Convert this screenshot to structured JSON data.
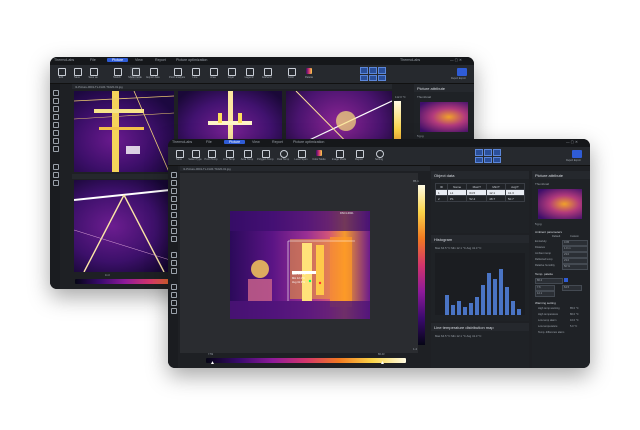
{
  "back_window": {
    "app_name": "ThermoLabs",
    "menus": [
      "File",
      "Picture",
      "View",
      "Report",
      "Picture optimization"
    ],
    "active_menu": "Picture",
    "ribbon_labels": [
      "Edit",
      "Save",
      "Save as",
      "Switch",
      "Show mode",
      "Export data",
      "Point analysis",
      "Line",
      "Area",
      "Layer",
      "Legend",
      "Isotherm",
      "Color",
      "Palette"
    ],
    "user": "ThermoLabs",
    "tab_title": "I1-Picture-0001-TL-FLIR-T1020-01.jpg",
    "panel_title": "Picture attribute",
    "panel_sub": "Thumbnail",
    "thumb_label": "5.jpg",
    "scale_max": "112.0 °C",
    "bar_low": "11.0",
    "report_button": "Report Export"
  },
  "front_window": {
    "app_name": "ThermoLabs",
    "menus": [
      "File",
      "Picture",
      "View",
      "Report",
      "Picture optimization"
    ],
    "active_menu": "Picture",
    "ribbon_labels": [
      "Save",
      "Select Type",
      "Point Temp",
      "Line Temp",
      "Area Temp",
      "Polygon Temp",
      "Oval Temp",
      "Level Span",
      "Color Mode",
      "Image Mode",
      "Report",
      "Setting"
    ],
    "report_button": "Report Export",
    "tab_title": "I1-Picture-0001-TL-FLIR-T1020-01.jpg",
    "scale_max": "85.1",
    "scale_min": "1.2",
    "bar_low": "7.59",
    "bar_high": "86.43",
    "image_caption": "DSC1-0021",
    "point_labels": [
      "Max 64.5°C",
      "Min 12.1°C",
      "Avg 41.3°C"
    ],
    "object_data": {
      "title": "Object data",
      "columns": [
        "ID",
        "Name",
        "Max/T",
        "Min/T",
        "Avg/T"
      ],
      "rows": [
        [
          "1",
          "L1",
          "64.5",
          "12.1",
          "41.3"
        ],
        [
          "2",
          "P1",
          "52.4",
          "48.7",
          "50.7"
        ]
      ]
    },
    "histogram": {
      "title": "Histogram",
      "summary": "Max 64.5 °C   Min 12.1 °C   Avg 41.3 °C"
    },
    "line_temp": {
      "title": "Line temperature distribution map",
      "summary": "Max 64.5 °C   Min 12.1 °C   Avg 41.3 °C"
    },
    "picture_attribute": {
      "title": "Picture attribute",
      "thumbnail": "Thumbnail",
      "thumb_label": "5.jpg",
      "ambient_title": "Ambient parameters",
      "options": [
        "Default",
        "Custom"
      ],
      "fields": [
        {
          "label": "Emissivity",
          "value": "0.95"
        },
        {
          "label": "Distance",
          "value": "1.0 m"
        },
        {
          "label": "Ambient temp",
          "value": "23.0"
        },
        {
          "label": "Reflected temp",
          "value": "23.0"
        },
        {
          "label": "Relative humidity",
          "value": "50 %"
        }
      ],
      "range_title": "Temp. palette",
      "range_values": [
        "86.4",
        "7.6",
        "64.5",
        "12.1"
      ],
      "warning_title": "Warning setting",
      "warning_rows": [
        {
          "label": "High temp warning",
          "value": "85.0 °C"
        },
        {
          "label": "High temperature",
          "value": "80.0 °C"
        },
        {
          "label": "Low temp alarm",
          "value": "10.0 °C"
        },
        {
          "label": "Low temperature",
          "value": "5.0 °C"
        },
        {
          "label": "Temp. difference alarm",
          "value": ""
        }
      ]
    }
  },
  "colors": {
    "accent": "#2f5cd6",
    "panel_bg": "#1f2226",
    "window_bg": "#1e2024"
  }
}
